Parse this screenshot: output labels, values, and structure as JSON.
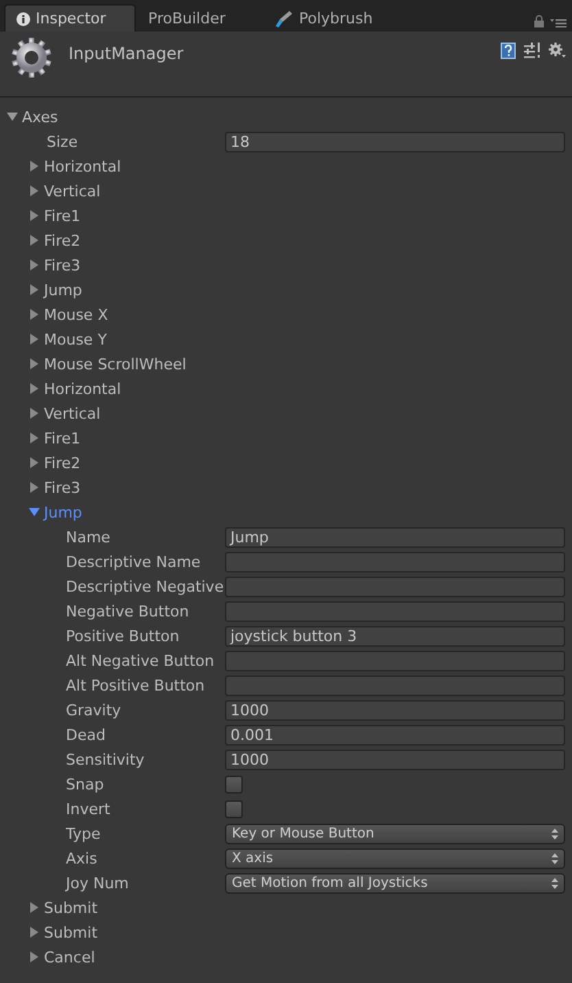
{
  "tabs": [
    {
      "label": "Inspector",
      "selected": true,
      "kind": "info"
    },
    {
      "label": "ProBuilder",
      "selected": false,
      "kind": "plain"
    },
    {
      "label": "Polybrush",
      "selected": false,
      "kind": "brush"
    }
  ],
  "header": {
    "title": "InputManager"
  },
  "axes": {
    "label": "Axes",
    "expanded": true,
    "size": {
      "label": "Size",
      "value": "18"
    },
    "items": [
      {
        "label": "Horizontal",
        "expanded": false,
        "selected": false
      },
      {
        "label": "Vertical",
        "expanded": false,
        "selected": false
      },
      {
        "label": "Fire1",
        "expanded": false,
        "selected": false
      },
      {
        "label": "Fire2",
        "expanded": false,
        "selected": false
      },
      {
        "label": "Fire3",
        "expanded": false,
        "selected": false
      },
      {
        "label": "Jump",
        "expanded": false,
        "selected": false
      },
      {
        "label": "Mouse X",
        "expanded": false,
        "selected": false
      },
      {
        "label": "Mouse Y",
        "expanded": false,
        "selected": false
      },
      {
        "label": "Mouse ScrollWheel",
        "expanded": false,
        "selected": false
      },
      {
        "label": "Horizontal",
        "expanded": false,
        "selected": false
      },
      {
        "label": "Vertical",
        "expanded": false,
        "selected": false
      },
      {
        "label": "Fire1",
        "expanded": false,
        "selected": false
      },
      {
        "label": "Fire2",
        "expanded": false,
        "selected": false
      },
      {
        "label": "Fire3",
        "expanded": false,
        "selected": false
      },
      {
        "label": "Jump",
        "expanded": true,
        "selected": true,
        "fields": [
          {
            "kind": "text",
            "label": "Name",
            "value": "Jump"
          },
          {
            "kind": "text",
            "label": "Descriptive Name"
          },
          {
            "kind": "text",
            "label": "Descriptive Negative"
          },
          {
            "kind": "text",
            "label": "Negative Button"
          },
          {
            "kind": "text",
            "label": "Positive Button",
            "value": "joystick button 3"
          },
          {
            "kind": "text",
            "label": "Alt Negative Button"
          },
          {
            "kind": "text",
            "label": "Alt Positive Button"
          },
          {
            "kind": "text",
            "label": "Gravity",
            "value": "1000"
          },
          {
            "kind": "text",
            "label": "Dead",
            "value": "0.001"
          },
          {
            "kind": "text",
            "label": "Sensitivity",
            "value": "1000"
          },
          {
            "kind": "checkbox",
            "label": "Snap",
            "checked": false
          },
          {
            "kind": "checkbox",
            "label": "Invert",
            "checked": false
          },
          {
            "kind": "dropdown",
            "label": "Type",
            "value": "Key or Mouse Button"
          },
          {
            "kind": "dropdown",
            "label": "Axis",
            "value": "X axis"
          },
          {
            "kind": "dropdown",
            "label": "Joy Num",
            "value": "Get Motion from all Joysticks"
          }
        ]
      },
      {
        "label": "Submit",
        "expanded": false,
        "selected": false
      },
      {
        "label": "Submit",
        "expanded": false,
        "selected": false
      },
      {
        "label": "Cancel",
        "expanded": false,
        "selected": false
      }
    ]
  }
}
